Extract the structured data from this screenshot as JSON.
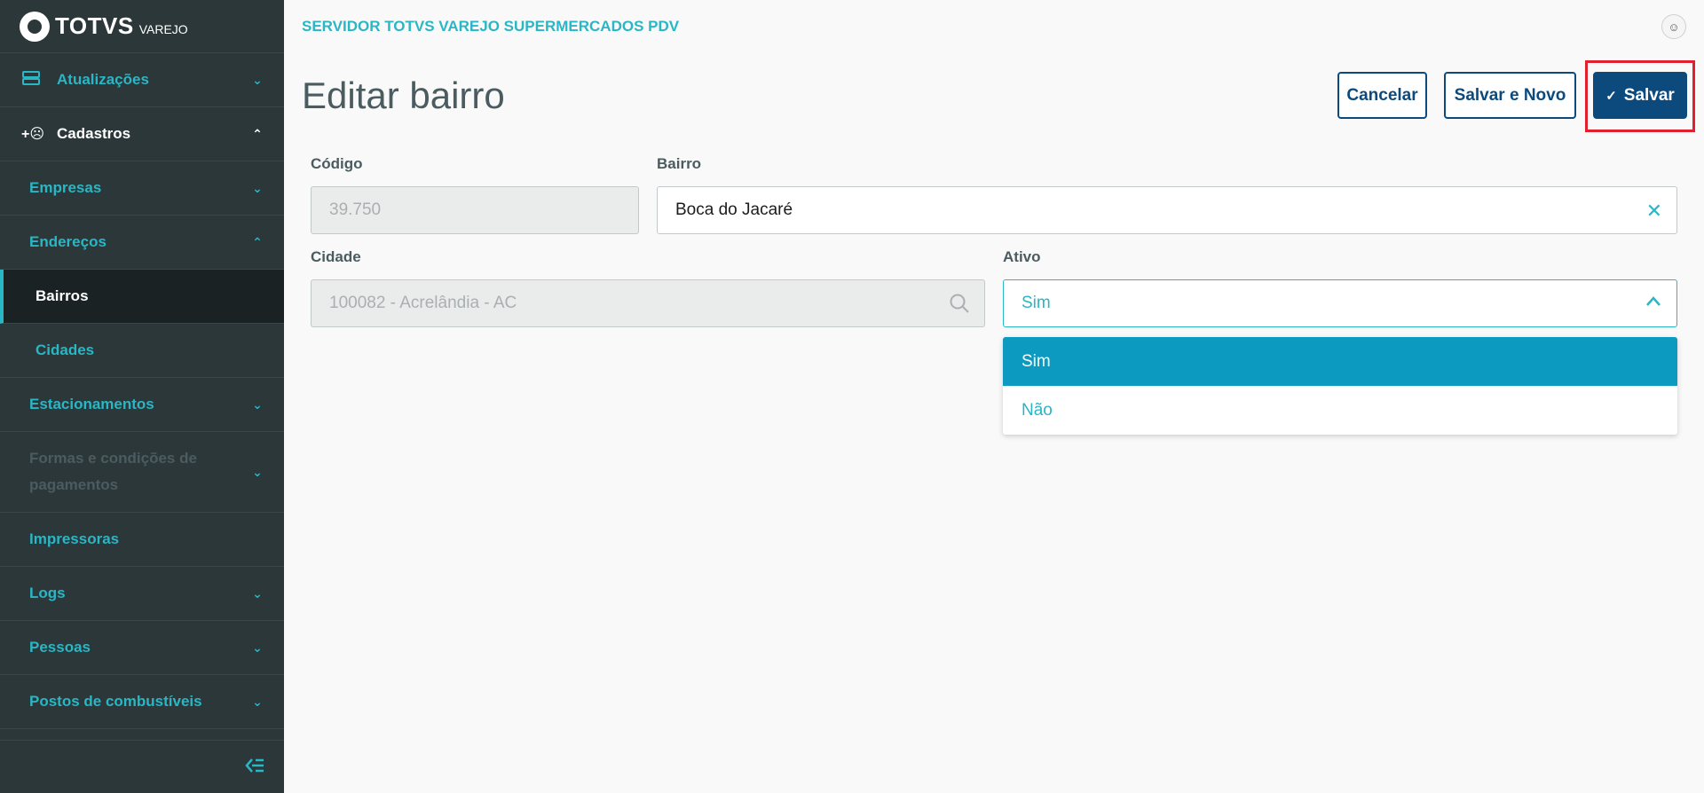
{
  "logo": {
    "text": "TOTVS",
    "sub": "VAREJO"
  },
  "sidebar": {
    "items": [
      {
        "label": "Atualizações",
        "icon": "server-icon"
      },
      {
        "label": "Cadastros",
        "icon": "add-user-icon"
      },
      {
        "label": "Empresas"
      },
      {
        "label": "Endereços"
      },
      {
        "label": "Bairros"
      },
      {
        "label": "Cidades"
      },
      {
        "label": "Estacionamentos"
      },
      {
        "label": "Formas e condições de pagamentos"
      },
      {
        "label": "Impressoras"
      },
      {
        "label": "Logs"
      },
      {
        "label": "Pessoas"
      },
      {
        "label": "Postos de combustíveis"
      }
    ]
  },
  "header": {
    "server_title": "SERVIDOR TOTVS VAREJO SUPERMERCADOS PDV"
  },
  "page": {
    "title": "Editar bairro"
  },
  "actions": {
    "cancel": "Cancelar",
    "save_new": "Salvar e Novo",
    "save": "Salvar"
  },
  "form": {
    "codigo": {
      "label": "Código",
      "value": "39.750"
    },
    "bairro": {
      "label": "Bairro",
      "value": "Boca do Jacaré"
    },
    "cidade": {
      "label": "Cidade",
      "value": "100082 - Acrelândia - AC"
    },
    "ativo": {
      "label": "Ativo",
      "value": "Sim",
      "options": [
        "Sim",
        "Não"
      ]
    }
  },
  "colors": {
    "accent": "#29b6c5",
    "primary": "#0c4a7d",
    "sidebar_bg": "#2c3739",
    "highlight": "#e0202e"
  }
}
